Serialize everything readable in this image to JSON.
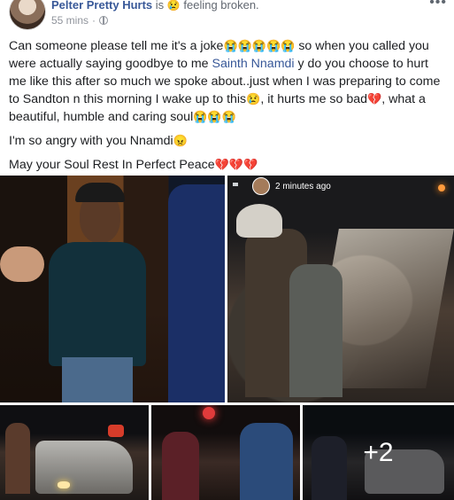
{
  "header": {
    "author": "Pelter Pretty Hurts",
    "is_word": "is",
    "feeling_emoji": "😢",
    "feeling_text": "feeling broken.",
    "timestamp": "55 mins",
    "separator": "·",
    "more_label": "•••"
  },
  "post": {
    "para1_a": "Can someone please tell me it's a joke",
    "para1_emoji_a": "😭😭😭😭😭",
    "para1_b": " so when you called you were actually saying goodbye to me ",
    "mention": "Sainth Nnamdi",
    "para1_c": " y do you choose to hurt me like this after so much we spoke about..just when I was preparing to come to Sandton n this morning I wake up to this",
    "para1_emoji_b": "😢",
    "para1_d": ", it hurts me so bad",
    "para1_emoji_c": "💔",
    "para1_e": ", what a beautiful, humble and caring soul",
    "para1_emoji_d": "😭😭😭",
    "para2_text": "I'm so angry with you Nnamdi",
    "para2_emoji": "😠",
    "para3_text": "May your Soul Rest In Perfect Peace",
    "para3_emoji": "💔💔💔"
  },
  "photos": {
    "photo2_time": "2 minutes ago",
    "more_count": "+2"
  }
}
